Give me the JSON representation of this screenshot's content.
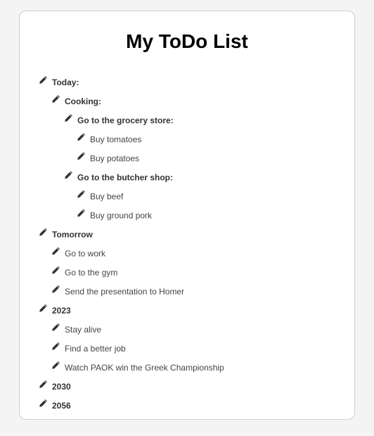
{
  "title": "My ToDo List",
  "icon_name": "pencil-icon",
  "colors": {
    "background": "#f4f4f4",
    "card": "#ffffff",
    "text": "#444444",
    "icon": "#333333"
  },
  "items": [
    {
      "label": "Today:",
      "level": 0,
      "bold": true
    },
    {
      "label": "Cooking:",
      "level": 1,
      "bold": true
    },
    {
      "label": "Go to the grocery store:",
      "level": 2,
      "bold": true
    },
    {
      "label": "Buy tomatoes",
      "level": 3,
      "bold": false
    },
    {
      "label": "Buy potatoes",
      "level": 3,
      "bold": false
    },
    {
      "label": "Go to the butcher shop:",
      "level": 2,
      "bold": true
    },
    {
      "label": "Buy beef",
      "level": 3,
      "bold": false
    },
    {
      "label": "Buy ground pork",
      "level": 3,
      "bold": false
    },
    {
      "label": "Tomorrow",
      "level": 0,
      "bold": true
    },
    {
      "label": "Go to work",
      "level": 1,
      "bold": false
    },
    {
      "label": "Go to the gym",
      "level": 1,
      "bold": false
    },
    {
      "label": "Send the presentation to Homer",
      "level": 1,
      "bold": false
    },
    {
      "label": "2023",
      "level": 0,
      "bold": true
    },
    {
      "label": "Stay alive",
      "level": 1,
      "bold": false
    },
    {
      "label": "Find a better job",
      "level": 1,
      "bold": false
    },
    {
      "label": "Watch PAOK win the Greek Championship",
      "level": 1,
      "bold": false
    },
    {
      "label": "2030",
      "level": 0,
      "bold": true
    },
    {
      "label": "2056",
      "level": 0,
      "bold": true
    }
  ]
}
